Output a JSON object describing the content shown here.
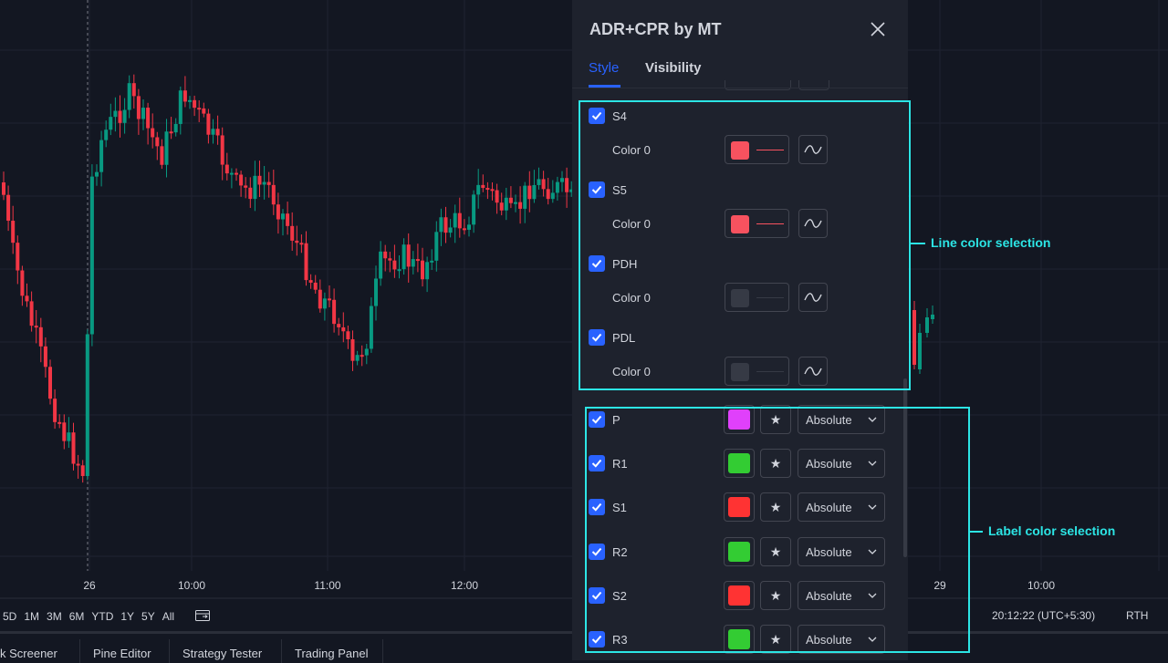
{
  "chart": {
    "time_labels": [
      "26",
      "10:00",
      "11:00",
      "12:00",
      "29",
      "10:00"
    ],
    "up_color": "#089981",
    "down_color": "#f23645"
  },
  "timeframes": [
    "5D",
    "1M",
    "3M",
    "6M",
    "YTD",
    "1Y",
    "5Y",
    "All"
  ],
  "status": {
    "time": "20:12:22 (UTC+5:30)",
    "session": "RTH"
  },
  "bottom_tabs": [
    "k Screener",
    "Pine Editor",
    "Strategy Tester",
    "Trading Panel"
  ],
  "dialog": {
    "title": "ADR+CPR by MT",
    "tabs": {
      "style": "Style",
      "visibility": "Visibility"
    },
    "line_rows": [
      {
        "label": "S4",
        "sub_label": "Color 0",
        "color": "#f7525f",
        "checked": true
      },
      {
        "label": "S5",
        "sub_label": "Color 0",
        "color": "#f7525f",
        "checked": true
      },
      {
        "label": "PDH",
        "sub_label": "Color 0",
        "color": "#363a45",
        "checked": true
      },
      {
        "label": "PDL",
        "sub_label": "Color 0",
        "color": "#363a45",
        "checked": true
      }
    ],
    "label_rows": [
      {
        "label": "P",
        "color": "#e040fb",
        "option": "Absolute",
        "checked": true
      },
      {
        "label": "R1",
        "color": "#33cc33",
        "option": "Absolute",
        "checked": true
      },
      {
        "label": "S1",
        "color": "#ff3333",
        "option": "Absolute",
        "checked": true
      },
      {
        "label": "R2",
        "color": "#33cc33",
        "option": "Absolute",
        "checked": true
      },
      {
        "label": "S2",
        "color": "#ff3333",
        "option": "Absolute",
        "checked": true
      },
      {
        "label": "R3",
        "color": "#33cc33",
        "option": "Absolute",
        "checked": true
      }
    ]
  },
  "annotations": {
    "line_color": "Line color selection",
    "label_color": "Label color selection",
    "color": "#2ce5e5"
  }
}
